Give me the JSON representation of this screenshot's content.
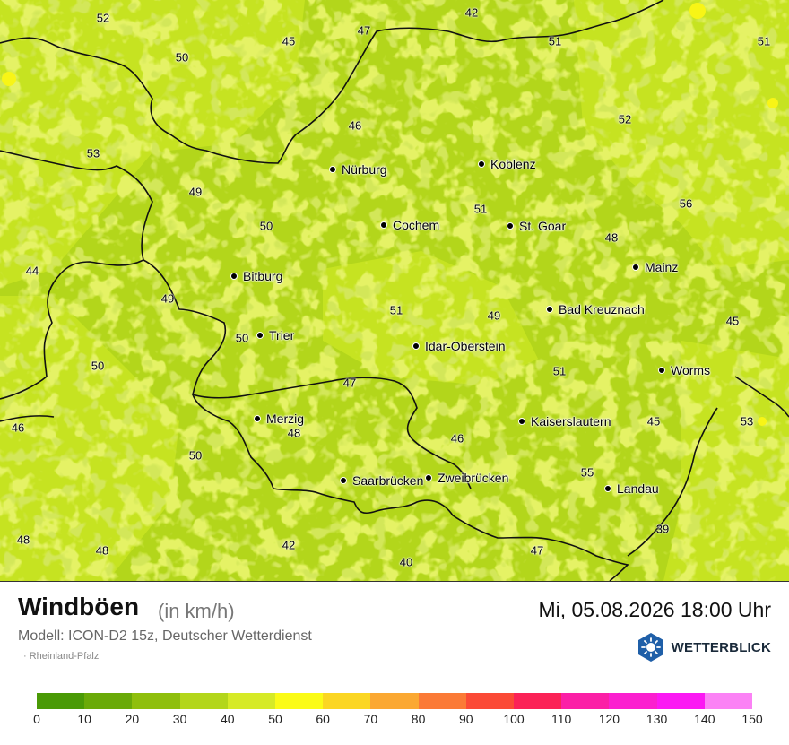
{
  "map": {
    "colors": {
      "base": "#b3d61b",
      "light": "#c6e321",
      "lighter": "#d6ea27",
      "dark": "#a6cc1a",
      "yellow": "#f8f516",
      "border": "#111111"
    },
    "values": [
      {
        "v": "52"
      },
      {
        "v": "42"
      },
      {
        "v": "45"
      },
      {
        "v": "47"
      },
      {
        "v": "51"
      },
      {
        "v": "51"
      },
      {
        "v": "50"
      },
      {
        "v": "46"
      },
      {
        "v": "52"
      },
      {
        "v": "53"
      },
      {
        "v": "49"
      },
      {
        "v": "56"
      },
      {
        "v": "50"
      },
      {
        "v": "51"
      },
      {
        "v": "48"
      },
      {
        "v": "44"
      },
      {
        "v": "49"
      },
      {
        "v": "51"
      },
      {
        "v": "49"
      },
      {
        "v": "45"
      },
      {
        "v": "50"
      },
      {
        "v": "50"
      },
      {
        "v": "51"
      },
      {
        "v": "47"
      },
      {
        "v": "46"
      },
      {
        "v": "48"
      },
      {
        "v": "45"
      },
      {
        "v": "53"
      },
      {
        "v": "46"
      },
      {
        "v": "50"
      },
      {
        "v": "55"
      },
      {
        "v": "39"
      },
      {
        "v": "48"
      },
      {
        "v": "48"
      },
      {
        "v": "42"
      },
      {
        "v": "40"
      },
      {
        "v": "47"
      }
    ],
    "cities": [
      {
        "name": "Nürburg"
      },
      {
        "name": "Koblenz"
      },
      {
        "name": "Cochem"
      },
      {
        "name": "St. Goar"
      },
      {
        "name": "Bitburg"
      },
      {
        "name": "Mainz"
      },
      {
        "name": "Bad Kreuznach"
      },
      {
        "name": "Trier"
      },
      {
        "name": "Idar-Oberstein"
      },
      {
        "name": "Worms"
      },
      {
        "name": "Merzig"
      },
      {
        "name": "Kaiserslautern"
      },
      {
        "name": "Saarbrücken"
      },
      {
        "name": "Zweibrücken"
      },
      {
        "name": "Landau"
      }
    ]
  },
  "footer": {
    "title": "Windböen",
    "unit": "(in km/h)",
    "model": "Modell: ICON-D2 15z, Deutscher Wetterdienst",
    "region": "· Rheinland-Pfalz",
    "datetime": "Mi, 05.08.2026 18:00 Uhr",
    "brand": "WETTERBLICK",
    "brand_icon": "sun-logo-icon"
  },
  "legend": {
    "colors": [
      "#4a9a06",
      "#6aaa08",
      "#8fbf0c",
      "#b3d61b",
      "#d6ea27",
      "#fbfb17",
      "#fbd623",
      "#fba832",
      "#fb7a36",
      "#fb4a36",
      "#fb2257",
      "#fb1fa6",
      "#fb1fcf",
      "#fb19f3",
      "#fb82f5"
    ],
    "ticks": [
      "0",
      "10",
      "20",
      "30",
      "40",
      "50",
      "60",
      "70",
      "80",
      "90",
      "100",
      "110",
      "120",
      "130",
      "140",
      "150"
    ]
  }
}
